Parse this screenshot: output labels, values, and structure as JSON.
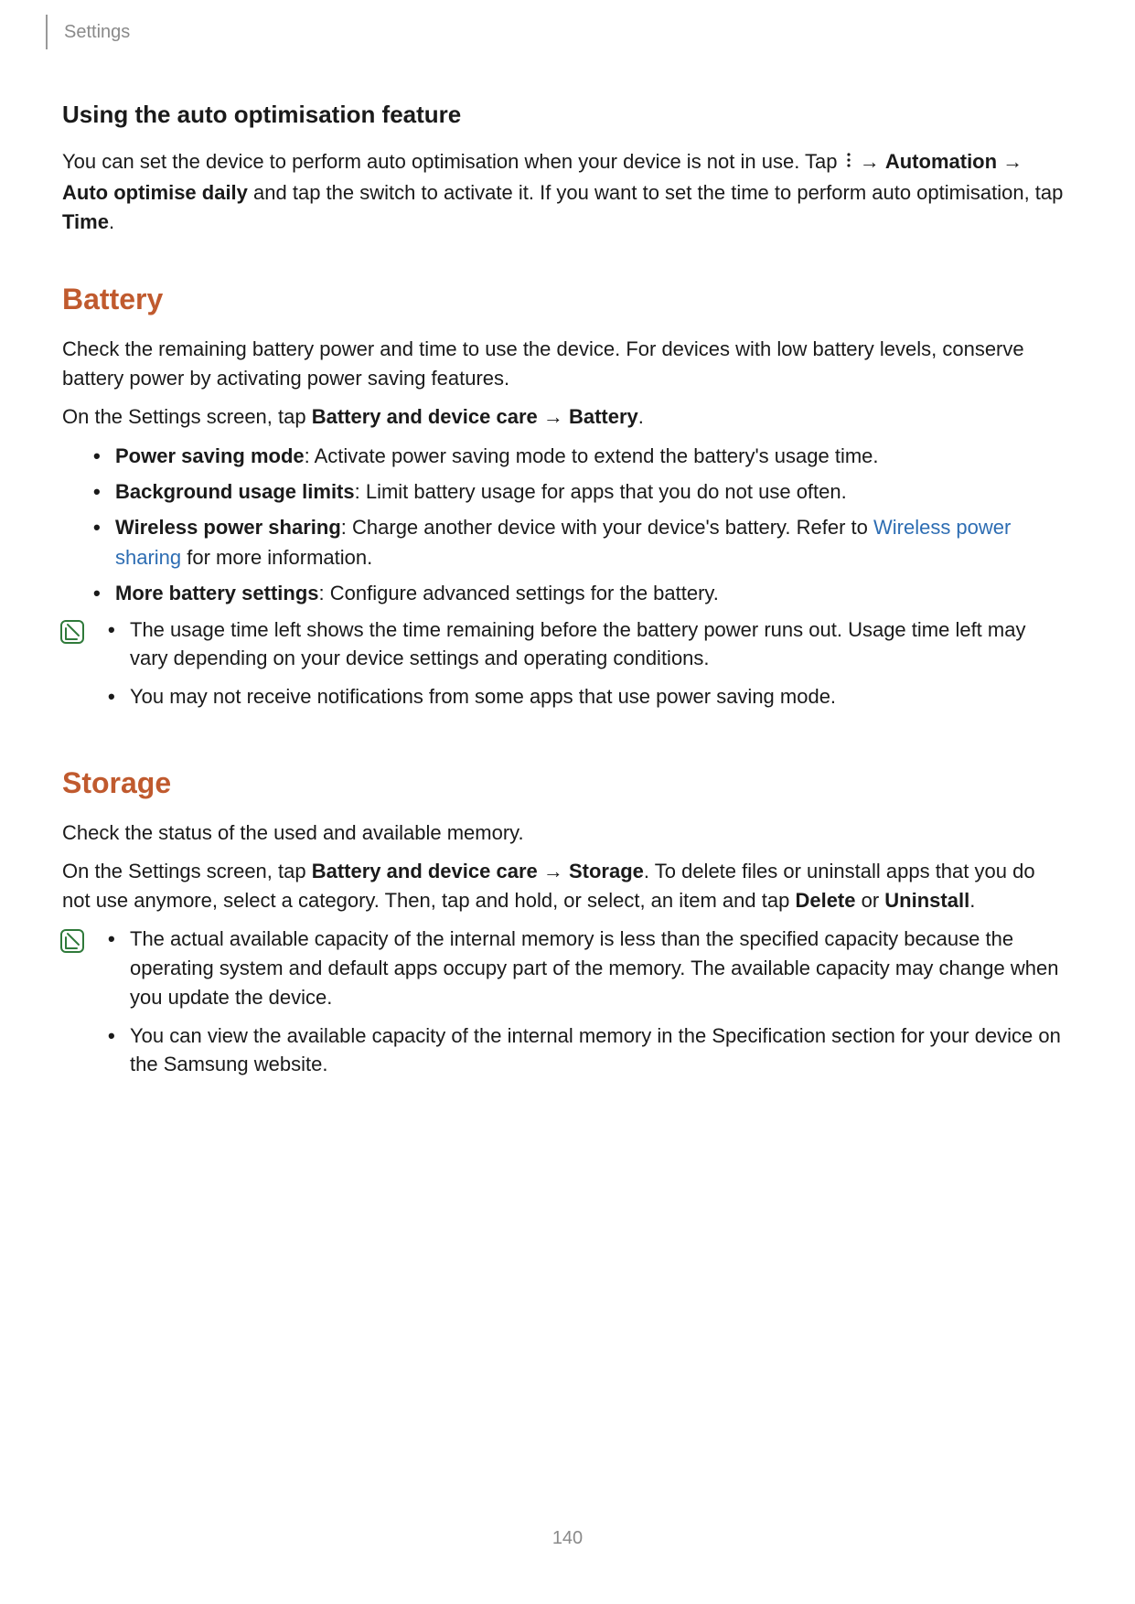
{
  "header": {
    "breadcrumb": "Settings"
  },
  "autoOptimisation": {
    "heading": "Using the auto optimisation feature",
    "para_prefix": "You can set the device to perform auto optimisation when your device is not in use. Tap ",
    "arrow1": " → ",
    "bold_automation": "Automation",
    "arrow2": " → ",
    "bold_autoOptimise": "Auto optimise daily",
    "para_mid": " and tap the switch to activate it. If you want to set the time to perform auto optimisation, tap ",
    "bold_time": "Time",
    "period": "."
  },
  "battery": {
    "heading": "Battery",
    "intro": "Check the remaining battery power and time to use the device. For devices with low battery levels, conserve battery power by activating power saving features.",
    "tap_prefix": "On the Settings screen, tap ",
    "tap_bold1": "Battery and device care",
    "tap_arrow": " → ",
    "tap_bold2": "Battery",
    "tap_suffix": ".",
    "bullets": {
      "b1_bold": "Power saving mode",
      "b1_text": ": Activate power saving mode to extend the battery's usage time.",
      "b2_bold": "Background usage limits",
      "b2_text": ": Limit battery usage for apps that you do not use often.",
      "b3_bold": "Wireless power sharing",
      "b3_text_before_link": ": Charge another device with your device's battery. Refer to ",
      "b3_link": "Wireless power sharing",
      "b3_text_after_link": " for more information.",
      "b4_bold": "More battery settings",
      "b4_text": ": Configure advanced settings for the battery."
    },
    "notes": {
      "n1": "The usage time left shows the time remaining before the battery power runs out. Usage time left may vary depending on your device settings and operating conditions.",
      "n2": "You may not receive notifications from some apps that use power saving mode."
    }
  },
  "storage": {
    "heading": "Storage",
    "intro": "Check the status of the used and available memory.",
    "tap_prefix": "On the Settings screen, tap ",
    "tap_bold1": "Battery and device care",
    "tap_arrow": " → ",
    "tap_bold2": "Storage",
    "tap_mid": ". To delete files or uninstall apps that you do not use anymore, select a category. Then, tap and hold, or select, an item and tap ",
    "tap_delete": "Delete",
    "tap_or": " or ",
    "tap_uninstall": "Uninstall",
    "tap_suffix": ".",
    "notes": {
      "n1": "The actual available capacity of the internal memory is less than the specified capacity because the operating system and default apps occupy part of the memory. The available capacity may change when you update the device.",
      "n2": "You can view the available capacity of the internal memory in the Specification section for your device on the Samsung website."
    }
  },
  "pageNumber": "140"
}
